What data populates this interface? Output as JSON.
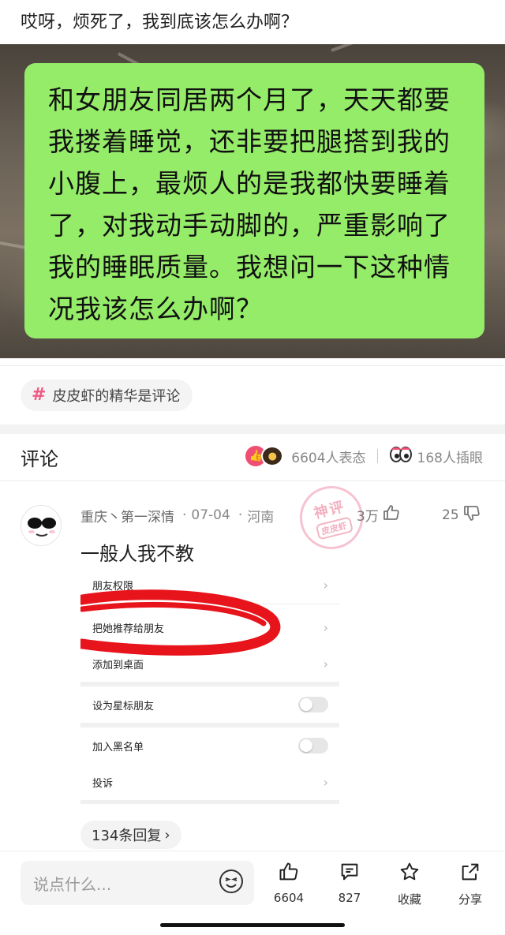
{
  "post": {
    "title": "哎呀，烦死了，我到底该怎么办啊？",
    "bubble_lines": [
      "和女朋友同居两个月了，天天都要",
      "我搂着睡觉，还非要把腿搭到我的",
      "小腹上，最烦人的是我都快要睡着",
      "了，对我动手动脚的，严重影响了",
      "我的睡眠质量。我想问一下这种情",
      "况我该怎么办啊？"
    ],
    "bubble_color": "#95ec69"
  },
  "topic": {
    "icon": "hash-icon",
    "label": "皮皮虾的精华是评论"
  },
  "comments_header": {
    "title": "评论",
    "reaction_count": "6604人表态",
    "watch_count": "168人插眼"
  },
  "comment": {
    "user": "重庆丶第一深情",
    "date": "07-04",
    "location": "河南",
    "likes": "3万",
    "dislikes": "25",
    "text": "一般人我不教",
    "badge": {
      "top": "神评",
      "bottom": "皮皮虾"
    },
    "embedded_settings": [
      {
        "label": "朋友权限",
        "control": "chevron"
      },
      {
        "label": "把她推荐给朋友",
        "control": "chevron"
      },
      {
        "label": "添加到桌面",
        "control": "chevron"
      },
      {
        "label": "设为星标朋友",
        "control": "toggle"
      },
      {
        "label": "加入黑名单",
        "control": "toggle"
      },
      {
        "label": "投诉",
        "control": "chevron"
      }
    ],
    "replies": "134条回复",
    "replies_chevron": "›"
  },
  "bottom_bar": {
    "placeholder": "说点什么...",
    "like_count": "6604",
    "comment_count": "827",
    "collect_label": "收藏",
    "share_label": "分享"
  },
  "colors": {
    "accent_pink": "#f05a84",
    "scribble_red": "#e8141c"
  }
}
